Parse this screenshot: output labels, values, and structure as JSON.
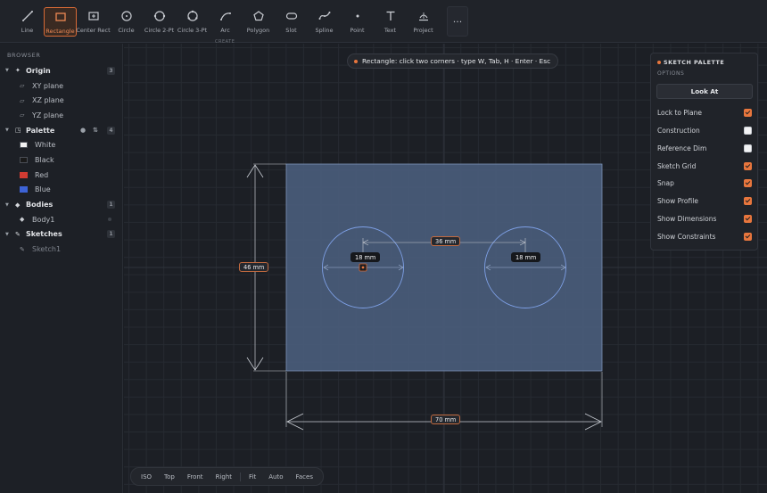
{
  "toolbar": {
    "tools": [
      {
        "id": "line",
        "label": "Line",
        "icon": "line-icon"
      },
      {
        "id": "rectangle",
        "label": "Rectangle",
        "icon": "rectangle-icon",
        "active": true
      },
      {
        "id": "center-rect",
        "label": "Center Rect",
        "icon": "center-rect-icon"
      },
      {
        "id": "circle",
        "label": "Circle",
        "icon": "circle-icon"
      },
      {
        "id": "circle-2pt",
        "label": "Circle 2-Pt",
        "icon": "circle-2pt-icon"
      },
      {
        "id": "circle-3pt",
        "label": "Circle 3-Pt",
        "icon": "circle-3pt-icon"
      },
      {
        "id": "arc",
        "label": "Arc",
        "icon": "arc-icon"
      },
      {
        "id": "polygon",
        "label": "Polygon",
        "icon": "polygon-icon"
      },
      {
        "id": "slot",
        "label": "Slot",
        "icon": "slot-icon"
      },
      {
        "id": "spline",
        "label": "Spline",
        "icon": "spline-icon"
      },
      {
        "id": "point",
        "label": "Point",
        "icon": "point-icon"
      },
      {
        "id": "text",
        "label": "Text",
        "icon": "text-icon"
      },
      {
        "id": "project",
        "label": "Project",
        "icon": "project-icon"
      }
    ],
    "more_label": "···",
    "group_label": "CREATE"
  },
  "browser": {
    "header": "BROWSER",
    "origin": {
      "label": "Origin",
      "count": "3",
      "items": [
        "XY plane",
        "XZ plane",
        "YZ plane"
      ]
    },
    "palette": {
      "label": "Palette",
      "count": "4",
      "items": [
        {
          "label": "White",
          "color": "#f2f2f2"
        },
        {
          "label": "Black",
          "color": "#1a1a1a"
        },
        {
          "label": "Red",
          "color": "#d03b32"
        },
        {
          "label": "Blue",
          "color": "#3d63d6"
        }
      ]
    },
    "bodies": {
      "label": "Bodies",
      "count": "1",
      "items": [
        "Body1"
      ]
    },
    "sketches": {
      "label": "Sketches",
      "count": "1",
      "items": [
        "Sketch1"
      ]
    }
  },
  "canvas": {
    "hint": "Rectangle: click two corners · type W, Tab, H · Enter · Esc",
    "dimensions": {
      "height": "46 mm",
      "width": "70 mm",
      "spacing": "36 mm",
      "dia_left": "18 mm",
      "dia_right": "18 mm"
    }
  },
  "sketch_palette": {
    "title": "SKETCH PALETTE",
    "subtitle": "OPTIONS",
    "look_at": "Look At",
    "options": [
      {
        "label": "Lock to Plane",
        "checked": true
      },
      {
        "label": "Construction",
        "checked": false
      },
      {
        "label": "Reference Dim",
        "checked": false
      },
      {
        "label": "Sketch Grid",
        "checked": true
      },
      {
        "label": "Snap",
        "checked": true
      },
      {
        "label": "Show Profile",
        "checked": true
      },
      {
        "label": "Show Dimensions",
        "checked": true
      },
      {
        "label": "Show Constraints",
        "checked": true
      }
    ]
  },
  "viewbar": {
    "group1": [
      "ISO",
      "Top",
      "Front",
      "Right"
    ],
    "group2": [
      "Fit",
      "Auto",
      "Faces"
    ]
  },
  "colors": {
    "accent": "#e8763d",
    "profile_fill": "#4a5d7c",
    "sketch_line": "#6f8fd8"
  }
}
